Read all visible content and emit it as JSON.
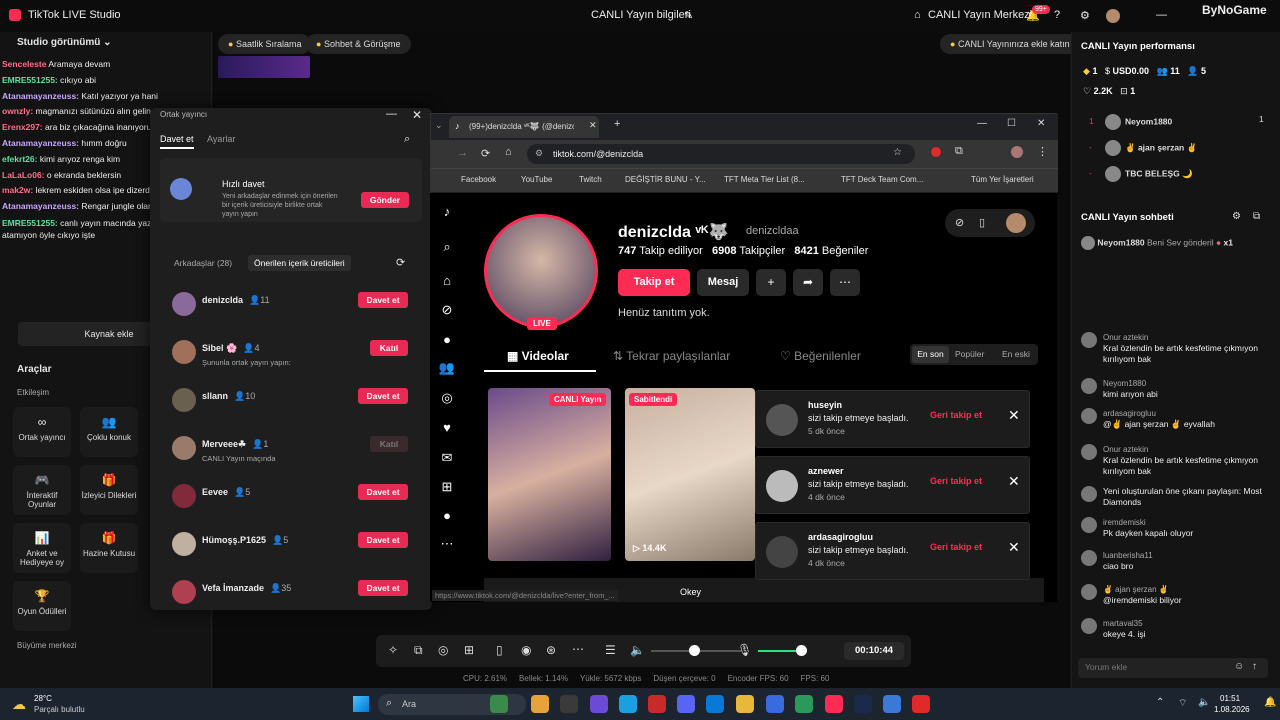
{
  "app": {
    "title": "TikTok LIVE Studio",
    "center_title": "CANLI Yayın bilgileri",
    "live_center": "CANLI Yayın Merkezi",
    "notif_count": "99+",
    "watermark": "ByNoGame"
  },
  "left": {
    "studio_view": "Studio görünümü",
    "add_source": "Kaynak ekle",
    "tools_title": "Araçlar",
    "engagement": "Etkileşim",
    "growth_center": "Büyüme merkezi",
    "chat": [
      {
        "user": "Senceleste",
        "text": "Aramaya devam"
      },
      {
        "user": "EMRE551255:",
        "text": "cıkıyo abi"
      },
      {
        "user": "Atanamayanzeuss:",
        "text": "Katıl yazıyor ya hani"
      },
      {
        "user": "ownzly:",
        "text": "magmanızı sütünüzü alın gelin meydana"
      },
      {
        "user": "Erenx297:",
        "text": "ara biz çıkacağına inanıyoruz"
      },
      {
        "user": "Atanamayanzeuss:",
        "text": "hımm doğru"
      },
      {
        "user": "efekrt26:",
        "text": "kimi arıyoz renga kim"
      },
      {
        "user": "LaLaLo06:",
        "text": "o ekranda beklersin"
      },
      {
        "user": "mak2w:",
        "text": "lekrem eskiden olsa ipe dizerdi elif boku"
      },
      {
        "user": "Atanamayanzeuss:",
        "text": "Rengar jungle olan"
      },
      {
        "user": "EMRE551255:",
        "text": "canlı yayın macında yazıyoya istek atamıyon öyle cıkıyo işte"
      }
    ],
    "tools": [
      {
        "icon": "∞",
        "label": "Ortak yayıncı"
      },
      {
        "icon": "👥",
        "label": "Çoklu konuk"
      },
      {
        "icon": "🎮",
        "label": "İnteraktif Oyunlar"
      },
      {
        "icon": "🎁",
        "label": "İzleyici Dilekleri"
      },
      {
        "icon": "📊",
        "label": "Anket ve Hediyeye oy"
      },
      {
        "icon": "🎁",
        "label": "Hazine Kutusu"
      },
      {
        "icon": "🏆",
        "label": "Oyun Ödülleri"
      }
    ]
  },
  "center": {
    "pills": [
      "Saatlik Sıralama",
      "Sohbet & Görüşme"
    ],
    "tip": "CANLI Yayınınıza ekle katın"
  },
  "popup": {
    "header": "Ortak yayıncı",
    "tab_invite": "Davet et",
    "tab_settings": "Ayarlar",
    "quick_title": "Hızlı davet",
    "quick_desc": "Yeni arkadaşlar edinmek için önerilen bir içerik üreticisiyle birlikte ortak yayın yapın",
    "send": "Gönder",
    "friends_tab": "Arkadaşlar (28)",
    "suggested_tab": "Önerilen içerik üreticileri",
    "rows": [
      {
        "name": "denizclda",
        "count": "11",
        "sub": "",
        "btn": "Davet et",
        "color": "#8a6a9a"
      },
      {
        "name": "Sibel 🌸",
        "count": "4",
        "sub": "Şununla ortak yayın yapın:",
        "btn": "Katıl",
        "color": "#a0705a"
      },
      {
        "name": "sllann",
        "count": "10",
        "sub": "",
        "btn": "Davet et",
        "color": "#6a6050"
      },
      {
        "name": "Merveee☘",
        "count": "1",
        "sub": "CANLI Yayın maçında",
        "btn": "Katıl",
        "color": "#9a7a6a"
      },
      {
        "name": "Eevee",
        "count": "5",
        "sub": "",
        "btn": "Davet et",
        "color": "#802a3a"
      },
      {
        "name": "Hümoşş.P1625",
        "count": "5",
        "sub": "",
        "btn": "Davet et",
        "color": "#c0b0a0"
      },
      {
        "name": "Vefa İmanzade",
        "count": "35",
        "sub": "",
        "btn": "Davet et",
        "color": "#b04050"
      }
    ]
  },
  "browser": {
    "tab": "(99+)denizclda ᵛᴷ🐺 (@denizcl",
    "url": "tiktok.com/@denizclda",
    "bookmarks": [
      "Facebook",
      "YouTube",
      "Twitch",
      "DEĞİŞTİR BUNU - Y...",
      "TFT Meta Tier List (8...",
      "TFT Deck Team Com...",
      "Tüm Yer İşaretleri"
    ],
    "status_url": "https://www.tiktok.com/@denizclda/live?enter_from_..."
  },
  "profile": {
    "name": "denizclda ᵛᴷ🐺",
    "handle": "denizcldaa",
    "following": "747",
    "following_label": "Takip ediliyor",
    "followers": "6908",
    "followers_label": "Takipçiler",
    "likes": "8421",
    "likes_label": "Beğeniler",
    "follow": "Takip et",
    "message": "Mesaj",
    "bio": "Henüz tanıtım yok.",
    "live": "LIVE",
    "tab_videos": "Videolar",
    "tab_reposts": "Tekrar paylaşılanlar",
    "tab_liked": "Beğenilenler",
    "sort": [
      "En son",
      "Popüler",
      "En eski"
    ],
    "badge_live": "CANLI Yayın",
    "badge_pinned": "Sabitlendi",
    "views": "14.4K",
    "okey": "Okey"
  },
  "notifs": [
    {
      "name": "huseyin",
      "msg": "sizi takip etmeye başladı.",
      "time": "5 dk önce",
      "action": "Geri takip et"
    },
    {
      "name": "aznewer",
      "msg": "sizi takip etmeye başladı.",
      "time": "4 dk önce",
      "action": "Geri takip et"
    },
    {
      "name": "ardasagirogluu",
      "msg": "sizi takip etmeye başladı.",
      "time": "4 dk önce",
      "action": "Geri takip et"
    }
  ],
  "controls": {
    "timer": "00:10:44",
    "stats": [
      "CPU: 2.61%",
      "Bellek: 1.14%",
      "Yükle: 5672 kbps",
      "Düşen çerçeve: 0",
      "Encoder FPS: 60",
      "FPS: 60"
    ]
  },
  "right": {
    "perf_title": "CANLI Yayın performansı",
    "perf": [
      "1",
      "USD0.00",
      "11",
      "5"
    ],
    "perf2": [
      "2.2K",
      "1"
    ],
    "rank": [
      {
        "pos": "1",
        "name": "Neyom1880",
        "val": "1"
      },
      {
        "pos": "-",
        "name": "✌ ajan şerzan ✌",
        "val": ""
      },
      {
        "pos": "-",
        "name": "TBC BELEŞG 🌙",
        "val": ""
      }
    ],
    "chat_title": "CANLI Yayın sohbeti",
    "gift_user": "Neyom1880",
    "gift_text": "Beni Sev gönderil",
    "gift_x": "x1",
    "messages": [
      {
        "user": "Onur aztekin",
        "text": "Kral özlendin be artık kesfetime çıkmıyon kırılıyom bak"
      },
      {
        "user": "Neyom1880",
        "text": "kimi arıyon abi"
      },
      {
        "user": "ardasagirogluu",
        "text": "@✌ ajan şerzan ✌ eyvallah"
      },
      {
        "user": "Onur aztekin",
        "text": "Kral özlendin be artık kesfetime çıkmıyon kırılıyom bak"
      },
      {
        "user": "",
        "text": "Yeni oluşturulan öne çıkanı paylaşın: Most Diamonds"
      },
      {
        "user": "iremdemiski",
        "text": "Pk dayken kapalı oluyor"
      },
      {
        "user": "luanberisha11",
        "text": "ciao bro"
      },
      {
        "user": "✌ ajan şerzan ✌",
        "text": "@iremdemiski biliyor"
      },
      {
        "user": "martaval35",
        "text": "okeye 4. işi"
      }
    ],
    "comment_placeholder": "Yorum ekle"
  },
  "taskbar": {
    "weather_temp": "28°C",
    "weather_text": "Parçalı bulutlu",
    "search": "Ara",
    "time": "01:51",
    "date": "1.08.2026"
  }
}
